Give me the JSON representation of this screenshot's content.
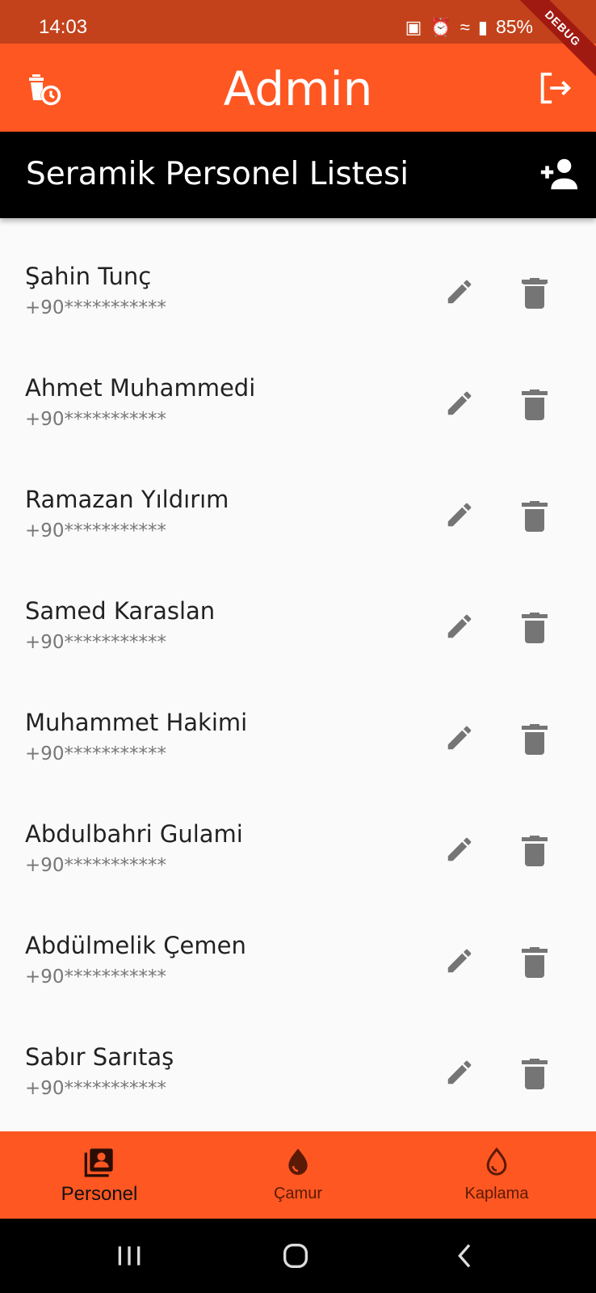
{
  "status_bar": {
    "time": "14:03",
    "battery": "85%",
    "debug": "DEBUG"
  },
  "app_bar": {
    "title": "Admin"
  },
  "sub_header": {
    "title": "Seramik Personel Listesi"
  },
  "personnel": [
    {
      "name": "Şahin Tunç",
      "phone": "+90***********"
    },
    {
      "name": "Ahmet Muhammedi",
      "phone": "+90***********"
    },
    {
      "name": "Ramazan Yıldırım",
      "phone": "+90***********"
    },
    {
      "name": "Samed Karaslan",
      "phone": "+90***********"
    },
    {
      "name": "Muhammet Hakimi",
      "phone": "+90***********"
    },
    {
      "name": "Abdulbahri Gulami",
      "phone": "+90***********"
    },
    {
      "name": "Abdülmelik Çemen",
      "phone": "+90***********"
    },
    {
      "name": "Sabır Sarıtaş",
      "phone": "+90***********"
    }
  ],
  "bottom_nav": {
    "items": [
      {
        "label": "Personel",
        "icon": "contacts-book-icon",
        "active": true
      },
      {
        "label": "Çamur",
        "icon": "drop-filled-icon",
        "active": false
      },
      {
        "label": "Kaplama",
        "icon": "drop-outline-icon",
        "active": false
      }
    ]
  },
  "colors": {
    "primary": "#ff5722",
    "status_bar": "#c3421b",
    "header": "#000000",
    "icon_grey": "#757575"
  }
}
